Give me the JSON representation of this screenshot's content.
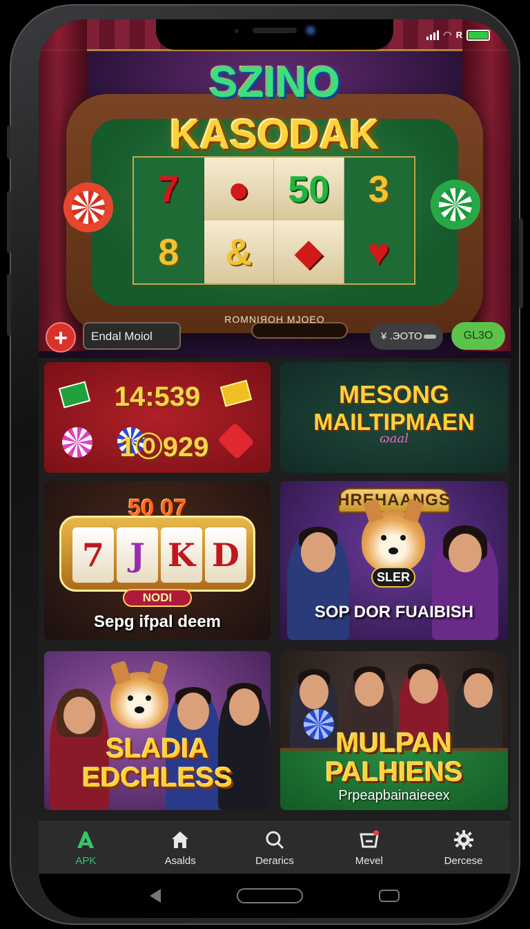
{
  "status_bar": {
    "icons": [
      "signal-icon",
      "wifi-icon",
      "r-box-icon",
      "battery-icon"
    ],
    "r_label": "R"
  },
  "hero": {
    "title_line1": "SZINO",
    "title_line2": "KASODAK",
    "reels": [
      {
        "symbol": "7",
        "style": "red"
      },
      {
        "symbol": "●",
        "style": "red"
      },
      {
        "symbol": "50",
        "style": "green"
      },
      {
        "symbol": "3",
        "style": "gold"
      },
      {
        "symbol": "8",
        "style": "gold"
      },
      {
        "symbol": "&",
        "style": "gold"
      },
      {
        "symbol": "◆",
        "style": "red"
      },
      {
        "symbol": "♥",
        "style": "red"
      }
    ],
    "table_caption": "ROMNIЯOH MJOEO",
    "name_field": "Endal Moiol",
    "coin_label": "¥ .ЭOTO",
    "play_label": "GL3O"
  },
  "cards": {
    "stats": {
      "value1": "14:539",
      "value2": "1⓪929"
    },
    "mesong": {
      "line1": "MESONG",
      "line2": "MAILTIPMAEN",
      "sub": "ɷaal"
    },
    "slot": {
      "top": "50 07",
      "reels": [
        "7",
        "J",
        "K",
        "D"
      ],
      "badge": "NODI",
      "caption": "Sepg ifpal deem"
    },
    "hrehaangs": {
      "top": "HREHAANGS",
      "badge": "SLER",
      "caption": "SOP DOR FUAIBISH"
    },
    "sladia": {
      "line1": "SLADIA",
      "line2": "EDCHLESS"
    },
    "mulpan": {
      "line1": "MULPAN",
      "line2": "PALHIENS",
      "sub": "Prpeapbainaieeex"
    }
  },
  "nav": {
    "items": [
      {
        "label": "APK",
        "icon": "apk-icon",
        "active": true
      },
      {
        "label": "Asalds",
        "icon": "home-icon",
        "active": false
      },
      {
        "label": "Derarics",
        "icon": "search-icon",
        "active": false
      },
      {
        "label": "Mevel",
        "icon": "cart-icon",
        "active": false
      },
      {
        "label": "Dercese",
        "icon": "gear-icon",
        "active": false
      }
    ]
  },
  "colors": {
    "accent": "#39c46a",
    "play_button": "#5cc34a",
    "nav_bg": "#2c2c2e"
  }
}
